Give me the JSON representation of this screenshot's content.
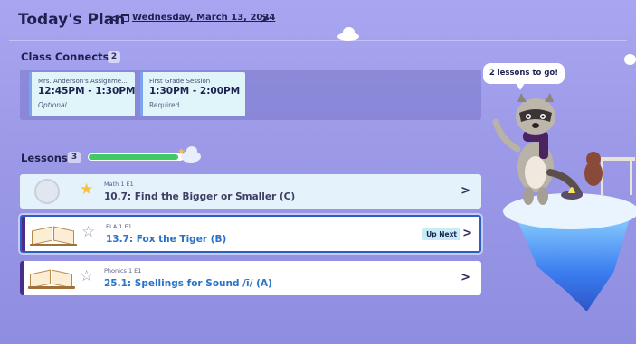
{
  "header": {
    "title": "Today's Plan",
    "prev_label": "<",
    "next_label": ">",
    "date": "Wednesday, March 13, 2024"
  },
  "class_connects": {
    "title": "Class Connects",
    "count": "2",
    "sessions": [
      {
        "name": "Mrs. Anderson's Assignme...",
        "time": "12:45PM - 1:30PM",
        "status": "Optional"
      },
      {
        "name": "First Grade Session",
        "time": "1:30PM - 2:00PM",
        "status": "Required"
      }
    ]
  },
  "lessons": {
    "title": "Lessons",
    "count": "3",
    "progress_fraction": 0.95,
    "items": [
      {
        "subject": "Math 1 E1",
        "name": "10.7: Find the Bigger or Smaller (C)",
        "chevron": ">",
        "state": "completed",
        "star": "filled"
      },
      {
        "subject": "ELA 1 E1",
        "name": "13.7: Fox the Tiger (B)",
        "chevron": ">",
        "badge": "Up Next",
        "state": "up-next",
        "star": "outline"
      },
      {
        "subject": "Phonics 1 E1",
        "name": "25.1: Spellings for Sound /ī/ (A)",
        "chevron": ">",
        "state": "upcoming",
        "star": "outline"
      }
    ]
  },
  "mascot": {
    "speech": "2 lessons to go!"
  },
  "colors": {
    "background": "#a9a6f1",
    "accent_blue": "#2c5fc6",
    "progress_green": "#3fcb62",
    "lesson_accent": "#4a2d8a",
    "star_gold": "#f6c33d"
  },
  "icons": {
    "calendar": "calendar-icon",
    "star_filled": "star-filled-icon",
    "star_outline": "star-outline-icon",
    "chevron": "chevron-right-icon"
  }
}
